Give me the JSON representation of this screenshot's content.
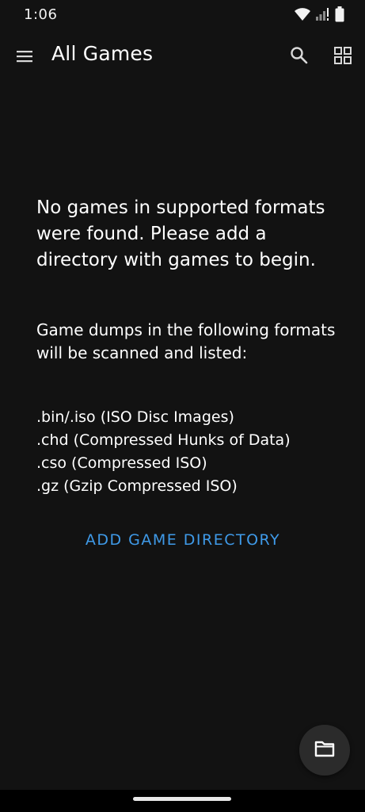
{
  "status_bar": {
    "time": "1:06",
    "icons": [
      "wifi-icon",
      "cell-signal-icon",
      "battery-icon"
    ]
  },
  "app_bar": {
    "title": "All Games",
    "menu_icon": "hamburger-menu-icon",
    "search_icon": "search-icon",
    "grid_icon": "grid-view-icon"
  },
  "empty_state": {
    "title": "No games in supported formats were found. Please add a directory with games to begin.",
    "description": "Game dumps in the following formats will be scanned and listed:",
    "formats": [
      ".bin/.iso (ISO Disc Images)",
      ".chd (Compressed Hunks of Data)",
      ".cso (Compressed ISO)",
      ".gz (Gzip Compressed ISO)"
    ],
    "add_button_label": "ADD GAME DIRECTORY"
  },
  "fab": {
    "icon": "folder-icon"
  },
  "colors": {
    "background": "#121212",
    "accent": "#3f9ae8",
    "text": "#ffffff",
    "fab": "#2b2b2b"
  }
}
